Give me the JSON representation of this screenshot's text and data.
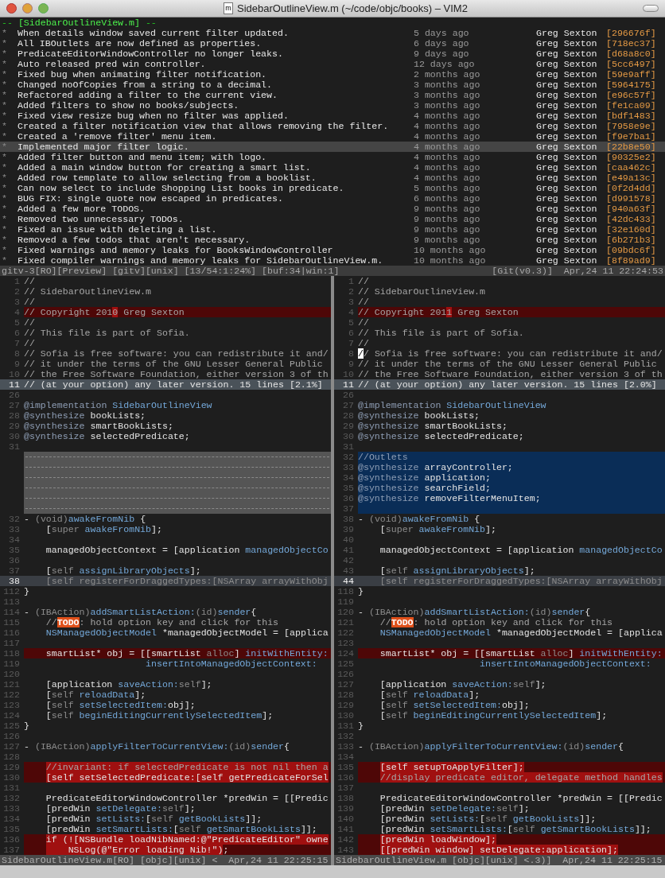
{
  "window": {
    "title": "SidebarOutlineView.m (~/code/objc/books) – VIM2",
    "file_icon": "m"
  },
  "log": {
    "header": {
      "prefix": "-- ",
      "name": "[SidebarOutlineView.m]",
      "suffix": " --"
    },
    "entries": [
      {
        "marker": "*",
        "message": "When details window saved current filter updated.",
        "age": "5 days ago",
        "author": "Greg Sexton",
        "hash": "[296676f]",
        "selected": false
      },
      {
        "marker": "*",
        "message": "All IBOutlets are now defined as properties.",
        "age": "6 days ago",
        "author": "Greg Sexton",
        "hash": "[718ec37]",
        "selected": false
      },
      {
        "marker": "*",
        "message": "PredicateEditorWindowController no longer leaks.",
        "age": "9 days ago",
        "author": "Greg Sexton",
        "hash": "[d68a8c0]",
        "selected": false
      },
      {
        "marker": "*",
        "message": "Auto released pred win controller.",
        "age": "12 days ago",
        "author": "Greg Sexton",
        "hash": "[5cc6497]",
        "selected": false
      },
      {
        "marker": "*",
        "message": "Fixed bug when animating filter notification.",
        "age": "2 months ago",
        "author": "Greg Sexton",
        "hash": "[59e9aff]",
        "selected": false
      },
      {
        "marker": "*",
        "message": "Changed noOfCopies from a string to a decimal.",
        "age": "3 months ago",
        "author": "Greg Sexton",
        "hash": "[5964175]",
        "selected": false
      },
      {
        "marker": "*",
        "message": "Refactored adding a filter to the current view.",
        "age": "3 months ago",
        "author": "Greg Sexton",
        "hash": "[e96c57f]",
        "selected": false
      },
      {
        "marker": "*",
        "message": "Added filters to show no books/subjects.",
        "age": "3 months ago",
        "author": "Greg Sexton",
        "hash": "[fe1ca09]",
        "selected": false
      },
      {
        "marker": "*",
        "message": "Fixed view resize bug when no filter was applied.",
        "age": "4 months ago",
        "author": "Greg Sexton",
        "hash": "[bdf1483]",
        "selected": false
      },
      {
        "marker": "*",
        "message": "Created a filter notification view that allows removing the filter.",
        "age": "4 months ago",
        "author": "Greg Sexton",
        "hash": "[7958e9e]",
        "selected": false
      },
      {
        "marker": "*",
        "message": "Created a 'remove filter' menu item.",
        "age": "4 months ago",
        "author": "Greg Sexton",
        "hash": "[f9e7ba1]",
        "selected": false
      },
      {
        "marker": "*",
        "message": "Implemented major filter logic.",
        "age": "4 months ago",
        "author": "Greg Sexton",
        "hash": "[22b8e50]",
        "selected": true
      },
      {
        "marker": "*",
        "message": "Added filter button and menu item; with logo.",
        "age": "4 months ago",
        "author": "Greg Sexton",
        "hash": "[90325e2]",
        "selected": false
      },
      {
        "marker": "*",
        "message": "Added a main window button for creating a smart list.",
        "age": "4 months ago",
        "author": "Greg Sexton",
        "hash": "[caa462c]",
        "selected": false
      },
      {
        "marker": "*",
        "message": "Added row template to allow selecting from a booklist.",
        "age": "4 months ago",
        "author": "Greg Sexton",
        "hash": "[e49a13c]",
        "selected": false
      },
      {
        "marker": "*",
        "message": "Can now select to include Shopping List books in predicate.",
        "age": "5 months ago",
        "author": "Greg Sexton",
        "hash": "[0f2d4dd]",
        "selected": false
      },
      {
        "marker": "*",
        "message": "BUG FIX: single quote now escaped in predicates.",
        "age": "6 months ago",
        "author": "Greg Sexton",
        "hash": "[d991578]",
        "selected": false
      },
      {
        "marker": "*",
        "message": "Added a few more TODOS.",
        "age": "9 months ago",
        "author": "Greg Sexton",
        "hash": "[940a63f]",
        "selected": false
      },
      {
        "marker": "*",
        "message": "Removed two unnecessary TODOs.",
        "age": "9 months ago",
        "author": "Greg Sexton",
        "hash": "[42dc433]",
        "selected": false
      },
      {
        "marker": "*",
        "message": "Fixed an issue with deleting a list.",
        "age": "9 months ago",
        "author": "Greg Sexton",
        "hash": "[32e160d]",
        "selected": false
      },
      {
        "marker": "*",
        "message": "Removed a few todos that aren't necessary.",
        "age": "9 months ago",
        "author": "Greg Sexton",
        "hash": "[6b271b3]",
        "selected": false
      },
      {
        "marker": "*",
        "message": "Fixed warnings and memory leaks for BooksWindowController",
        "age": "10 months ago",
        "author": "Greg Sexton",
        "hash": "[09bdc6f]",
        "selected": false
      },
      {
        "marker": "*",
        "message": "Fixed compiler warnings and memory leaks for SidebarOutlineView.m.",
        "age": "10 months ago",
        "author": "Greg Sexton",
        "hash": "[8f89ad9]",
        "selected": false
      }
    ],
    "status_bar": {
      "left": "gitv-3[RO][Preview] [gitv][unix] [13/54:1:24%] [buf:34|win:1]",
      "right": "[Git(v0.3)]  Apr,24 11 22:24:53"
    }
  },
  "panes": [
    {
      "lines": [
        {
          "n": "1",
          "kind": "normal",
          "parts": [
            {
              "kind": "comment",
              "t": "//"
            }
          ]
        },
        {
          "n": "2",
          "kind": "normal",
          "parts": [
            {
              "kind": "comment",
              "t": "// SidebarOutlineView.m"
            }
          ]
        },
        {
          "n": "3",
          "kind": "normal",
          "parts": [
            {
              "kind": "comment",
              "t": "//"
            }
          ]
        },
        {
          "n": "4",
          "kind": "change",
          "parts": [
            {
              "kind": "comment",
              "t": "// Copyright 201",
              "diff": false
            },
            {
              "kind": "comment",
              "t": "0",
              "diff": true
            },
            {
              "kind": "comment",
              "t": " Greg Sexton",
              "diff": false
            }
          ]
        },
        {
          "n": "5",
          "kind": "normal",
          "parts": [
            {
              "kind": "comment",
              "t": "//"
            }
          ]
        },
        {
          "n": "6",
          "kind": "normal",
          "parts": [
            {
              "kind": "comment",
              "t": "// This file is part of Sofia."
            }
          ]
        },
        {
          "n": "7",
          "kind": "normal",
          "parts": [
            {
              "kind": "comment",
              "t": "//"
            }
          ]
        },
        {
          "n": "8",
          "kind": "normal",
          "parts": [
            {
              "kind": "comment",
              "t": "// Sofia is free software: you can redistribute it and/"
            }
          ]
        },
        {
          "n": "9",
          "kind": "normal",
          "parts": [
            {
              "kind": "comment",
              "t": "// it under the terms of the GNU Lesser General Public"
            }
          ]
        },
        {
          "n": "10",
          "kind": "normal",
          "parts": [
            {
              "kind": "comment",
              "t": "// the Free Software Foundation, either version 3 of th"
            }
          ]
        },
        {
          "n": "11",
          "kind": "fold",
          "parts": [
            {
              "kind": "plain",
              "t": "// (at your option) any later version. 15 lines [2.1%]"
            }
          ]
        },
        {
          "n": "26",
          "kind": "normal"
        },
        {
          "n": "27",
          "kind": "normal",
          "parts": [
            {
              "kind": "keyword",
              "t": "@implementation "
            },
            {
              "kind": "method",
              "t": "SidebarOutlineView"
            }
          ]
        },
        {
          "n": "28",
          "kind": "normal",
          "parts": [
            {
              "kind": "keyword",
              "t": "@synthesize "
            },
            {
              "kind": "plain",
              "t": "bookLists;"
            }
          ]
        },
        {
          "n": "29",
          "kind": "normal",
          "parts": [
            {
              "kind": "keyword",
              "t": "@synthesize "
            },
            {
              "kind": "plain",
              "t": "smartBookLists;"
            }
          ]
        },
        {
          "n": "30",
          "kind": "normal",
          "parts": [
            {
              "kind": "keyword",
              "t": "@synthesize "
            },
            {
              "kind": "plain",
              "t": "selectedPredicate;"
            }
          ]
        },
        {
          "n": "31",
          "kind": "normal"
        },
        {
          "kind": "filler"
        },
        {
          "kind": "filler"
        },
        {
          "kind": "filler"
        },
        {
          "kind": "filler"
        },
        {
          "kind": "filler"
        },
        {
          "kind": "filler"
        },
        {
          "n": "32",
          "kind": "normal",
          "parts": [
            {
              "kind": "plain",
              "t": "- "
            },
            {
              "kind": "dim",
              "t": "(void)"
            },
            {
              "kind": "method",
              "t": "awakeFromNib"
            },
            {
              "kind": "plain",
              "t": " {"
            }
          ]
        },
        {
          "n": "33",
          "kind": "normal",
          "parts": [
            {
              "kind": "plain",
              "t": "    ["
            },
            {
              "kind": "dim",
              "t": "super "
            },
            {
              "kind": "method",
              "t": "awakeFromNib"
            },
            {
              "kind": "plain",
              "t": "];"
            }
          ]
        },
        {
          "n": "34",
          "kind": "normal"
        },
        {
          "n": "35",
          "kind": "normal",
          "parts": [
            {
              "kind": "plain",
              "t": "    managedObjectContext = [application "
            },
            {
              "kind": "method",
              "t": "managedObjectCo"
            }
          ]
        },
        {
          "n": "36",
          "kind": "normal"
        },
        {
          "n": "37",
          "kind": "normal",
          "parts": [
            {
              "kind": "plain",
              "t": "    ["
            },
            {
              "kind": "dim",
              "t": "self "
            },
            {
              "kind": "method",
              "t": "assignLibraryObjects"
            },
            {
              "kind": "plain",
              "t": "];"
            }
          ]
        },
        {
          "n": "38",
          "kind": "cursorline",
          "parts": [
            {
              "kind": "dim",
              "t": "    [self registerForDraggedTypes:[NSArray arrayWithObj"
            }
          ]
        },
        {
          "n": "112",
          "kind": "normal",
          "parts": [
            {
              "kind": "plain",
              "t": "}"
            }
          ]
        },
        {
          "n": "113",
          "kind": "normal"
        },
        {
          "n": "114",
          "kind": "normal",
          "parts": [
            {
              "kind": "plain",
              "t": "- "
            },
            {
              "kind": "dim",
              "t": "(IBAction)"
            },
            {
              "kind": "method",
              "t": "addSmartListAction:"
            },
            {
              "kind": "dim",
              "t": "(id)"
            },
            {
              "kind": "method",
              "t": "sender"
            },
            {
              "kind": "plain",
              "t": "{"
            }
          ]
        },
        {
          "n": "115",
          "kind": "normal",
          "parts": [
            {
              "kind": "comment",
              "t": "    //"
            },
            {
              "kind": "todo",
              "t": "TODO"
            },
            {
              "kind": "comment",
              "t": ": hold option key and click for this"
            }
          ]
        },
        {
          "n": "116",
          "kind": "normal",
          "parts": [
            {
              "kind": "method",
              "t": "    NSManagedObjectModel"
            },
            {
              "kind": "plain",
              "t": " *managedObjectModel = [applica"
            }
          ]
        },
        {
          "n": "117",
          "kind": "normal"
        },
        {
          "n": "118",
          "kind": "change",
          "parts": [
            {
              "kind": "plain",
              "t": "    smartList* obj = [[smartList "
            },
            {
              "kind": "dim",
              "t": "alloc"
            },
            {
              "kind": "plain",
              "t": "] "
            },
            {
              "kind": "method",
              "t": "initWithEntity:"
            }
          ]
        },
        {
          "n": "119",
          "kind": "normal",
          "parts": [
            {
              "kind": "method",
              "t": "                      insertIntoManagedObjectContext:"
            }
          ]
        },
        {
          "n": "120",
          "kind": "normal"
        },
        {
          "n": "121",
          "kind": "normal",
          "parts": [
            {
              "kind": "plain",
              "t": "    [application "
            },
            {
              "kind": "method",
              "t": "saveAction:"
            },
            {
              "kind": "dim",
              "t": "self"
            },
            {
              "kind": "plain",
              "t": "];"
            }
          ]
        },
        {
          "n": "122",
          "kind": "normal",
          "parts": [
            {
              "kind": "plain",
              "t": "    ["
            },
            {
              "kind": "dim",
              "t": "self "
            },
            {
              "kind": "method",
              "t": "reloadData"
            },
            {
              "kind": "plain",
              "t": "];"
            }
          ]
        },
        {
          "n": "123",
          "kind": "normal",
          "parts": [
            {
              "kind": "plain",
              "t": "    ["
            },
            {
              "kind": "dim",
              "t": "self "
            },
            {
              "kind": "method",
              "t": "setSelectedItem:"
            },
            {
              "kind": "plain",
              "t": "obj];"
            }
          ]
        },
        {
          "n": "124",
          "kind": "normal",
          "parts": [
            {
              "kind": "plain",
              "t": "    ["
            },
            {
              "kind": "dim",
              "t": "self "
            },
            {
              "kind": "method",
              "t": "beginEditingCurrentlySelectedItem"
            },
            {
              "kind": "plain",
              "t": "];"
            }
          ]
        },
        {
          "n": "125",
          "kind": "normal",
          "parts": [
            {
              "kind": "plain",
              "t": "}"
            }
          ]
        },
        {
          "n": "126",
          "kind": "normal"
        },
        {
          "n": "127",
          "kind": "normal",
          "parts": [
            {
              "kind": "plain",
              "t": "- "
            },
            {
              "kind": "dim",
              "t": "(IBAction)"
            },
            {
              "kind": "method",
              "t": "applyFilterToCurrentView:"
            },
            {
              "kind": "dim",
              "t": "(id)"
            },
            {
              "kind": "method",
              "t": "sender"
            },
            {
              "kind": "plain",
              "t": "{"
            }
          ]
        },
        {
          "n": "128",
          "kind": "normal"
        },
        {
          "n": "129",
          "kind": "change",
          "indent": true,
          "parts": [
            {
              "kind": "comment",
              "t": "//invariant: if selectedPredicate is not nil then a",
              "diff": true
            }
          ]
        },
        {
          "n": "130",
          "kind": "change",
          "indent": true,
          "parts": [
            {
              "kind": "plain",
              "t": "[self setSelectedPredicate:[self getPredicateForSel",
              "diff": true
            }
          ]
        },
        {
          "n": "131",
          "kind": "normal"
        },
        {
          "n": "132",
          "kind": "normal",
          "parts": [
            {
              "kind": "plain",
              "t": "    PredicateEditorWindowController *predWin = [[Predic"
            }
          ]
        },
        {
          "n": "133",
          "kind": "normal",
          "parts": [
            {
              "kind": "plain",
              "t": "    [predWin "
            },
            {
              "kind": "method",
              "t": "setDelegate:"
            },
            {
              "kind": "dim",
              "t": "self"
            },
            {
              "kind": "plain",
              "t": "];"
            }
          ]
        },
        {
          "n": "134",
          "kind": "normal",
          "parts": [
            {
              "kind": "plain",
              "t": "    [predWin "
            },
            {
              "kind": "method",
              "t": "setLists:"
            },
            {
              "kind": "plain",
              "t": "["
            },
            {
              "kind": "dim",
              "t": "self "
            },
            {
              "kind": "method",
              "t": "getBookLists"
            },
            {
              "kind": "plain",
              "t": "]];"
            }
          ]
        },
        {
          "n": "135",
          "kind": "normal",
          "parts": [
            {
              "kind": "plain",
              "t": "    [predWin "
            },
            {
              "kind": "method",
              "t": "setSmartLists:"
            },
            {
              "kind": "plain",
              "t": "["
            },
            {
              "kind": "dim",
              "t": "self "
            },
            {
              "kind": "method",
              "t": "getSmartBookLists"
            },
            {
              "kind": "plain",
              "t": "]];"
            }
          ]
        },
        {
          "n": "136",
          "kind": "change",
          "indent": true,
          "parts": [
            {
              "kind": "plain",
              "t": "if (![NSBundle loadNibNamed:@\"PredicateEditor\" owne",
              "diff": true
            }
          ]
        },
        {
          "n": "137",
          "kind": "change",
          "indent": true,
          "parts": [
            {
              "kind": "plain",
              "t": "    NSLog(@\"Error loading Nib!\")",
              "diff": true
            },
            {
              "kind": "plain",
              "t": ";",
              "diff": false
            }
          ]
        }
      ],
      "status_bar": "SidebarOutlineView.m[RO] [objc][unix] <  Apr,24 11 22:25:15"
    },
    {
      "lines": [
        {
          "n": "1",
          "kind": "normal",
          "parts": [
            {
              "kind": "comment",
              "t": "//"
            }
          ]
        },
        {
          "n": "2",
          "kind": "normal",
          "parts": [
            {
              "kind": "comment",
              "t": "// SidebarOutlineView.m"
            }
          ]
        },
        {
          "n": "3",
          "kind": "normal",
          "parts": [
            {
              "kind": "comment",
              "t": "//"
            }
          ]
        },
        {
          "n": "4",
          "kind": "change",
          "parts": [
            {
              "kind": "comment",
              "t": "// Copyright 201",
              "diff": false
            },
            {
              "kind": "comment",
              "t": "1",
              "diff": true
            },
            {
              "kind": "comment",
              "t": " Greg Sexton",
              "diff": false
            }
          ]
        },
        {
          "n": "5",
          "kind": "normal",
          "parts": [
            {
              "kind": "comment",
              "t": "//"
            }
          ]
        },
        {
          "n": "6",
          "kind": "normal",
          "parts": [
            {
              "kind": "comment",
              "t": "// This file is part of Sofia."
            }
          ]
        },
        {
          "n": "7",
          "kind": "normal",
          "parts": [
            {
              "kind": "comment",
              "t": "//"
            }
          ]
        },
        {
          "n": "8",
          "kind": "normal",
          "parts": [
            {
              "kind": "cursor",
              "t": "/"
            },
            {
              "kind": "comment",
              "t": "/ Sofia is free software: you can redistribute it and/"
            }
          ]
        },
        {
          "n": "9",
          "kind": "normal",
          "parts": [
            {
              "kind": "comment",
              "t": "// it under the terms of the GNU Lesser General Public"
            }
          ]
        },
        {
          "n": "10",
          "kind": "normal",
          "parts": [
            {
              "kind": "comment",
              "t": "// the Free Software Foundation, either version 3 of th"
            }
          ]
        },
        {
          "n": "11",
          "kind": "fold",
          "parts": [
            {
              "kind": "plain",
              "t": "// (at your option) any later version. 15 lines [2.0%]"
            }
          ]
        },
        {
          "n": "26",
          "kind": "normal"
        },
        {
          "n": "27",
          "kind": "normal",
          "parts": [
            {
              "kind": "keyword",
              "t": "@implementation "
            },
            {
              "kind": "method",
              "t": "SidebarOutlineView"
            }
          ]
        },
        {
          "n": "28",
          "kind": "normal",
          "parts": [
            {
              "kind": "keyword",
              "t": "@synthesize "
            },
            {
              "kind": "plain",
              "t": "bookLists;"
            }
          ]
        },
        {
          "n": "29",
          "kind": "normal",
          "parts": [
            {
              "kind": "keyword",
              "t": "@synthesize "
            },
            {
              "kind": "plain",
              "t": "smartBookLists;"
            }
          ]
        },
        {
          "n": "30",
          "kind": "normal",
          "parts": [
            {
              "kind": "keyword",
              "t": "@synthesize "
            },
            {
              "kind": "plain",
              "t": "selectedPredicate;"
            }
          ]
        },
        {
          "n": "31",
          "kind": "normal"
        },
        {
          "n": "32",
          "kind": "add",
          "parts": [
            {
              "kind": "keyword",
              "t": "//Outlets"
            }
          ]
        },
        {
          "n": "33",
          "kind": "add",
          "parts": [
            {
              "kind": "keyword",
              "t": "@synthesize "
            },
            {
              "kind": "plain",
              "t": "arrayController;"
            }
          ]
        },
        {
          "n": "34",
          "kind": "add",
          "parts": [
            {
              "kind": "keyword",
              "t": "@synthesize "
            },
            {
              "kind": "plain",
              "t": "application;"
            }
          ]
        },
        {
          "n": "35",
          "kind": "add",
          "parts": [
            {
              "kind": "keyword",
              "t": "@synthesize "
            },
            {
              "kind": "plain",
              "t": "searchField;"
            }
          ]
        },
        {
          "n": "36",
          "kind": "add",
          "parts": [
            {
              "kind": "keyword",
              "t": "@synthesize "
            },
            {
              "kind": "plain",
              "t": "removeFilterMenuItem;"
            }
          ]
        },
        {
          "n": "37",
          "kind": "add"
        },
        {
          "n": "38",
          "kind": "normal",
          "parts": [
            {
              "kind": "plain",
              "t": "- "
            },
            {
              "kind": "dim",
              "t": "(void)"
            },
            {
              "kind": "method",
              "t": "awakeFromNib"
            },
            {
              "kind": "plain",
              "t": " {"
            }
          ]
        },
        {
          "n": "39",
          "kind": "normal",
          "parts": [
            {
              "kind": "plain",
              "t": "    ["
            },
            {
              "kind": "dim",
              "t": "super "
            },
            {
              "kind": "method",
              "t": "awakeFromNib"
            },
            {
              "kind": "plain",
              "t": "];"
            }
          ]
        },
        {
          "n": "40",
          "kind": "normal"
        },
        {
          "n": "41",
          "kind": "normal",
          "parts": [
            {
              "kind": "plain",
              "t": "    managedObjectContext = [application "
            },
            {
              "kind": "method",
              "t": "managedObjectCo"
            }
          ]
        },
        {
          "n": "42",
          "kind": "normal"
        },
        {
          "n": "43",
          "kind": "normal",
          "parts": [
            {
              "kind": "plain",
              "t": "    ["
            },
            {
              "kind": "dim",
              "t": "self "
            },
            {
              "kind": "method",
              "t": "assignLibraryObjects"
            },
            {
              "kind": "plain",
              "t": "];"
            }
          ]
        },
        {
          "n": "44",
          "kind": "cursorline",
          "parts": [
            {
              "kind": "dim",
              "t": "    [self registerForDraggedTypes:[NSArray arrayWithObj"
            }
          ]
        },
        {
          "n": "118",
          "kind": "normal",
          "parts": [
            {
              "kind": "plain",
              "t": "}"
            }
          ]
        },
        {
          "n": "119",
          "kind": "normal"
        },
        {
          "n": "120",
          "kind": "normal",
          "parts": [
            {
              "kind": "plain",
              "t": "- "
            },
            {
              "kind": "dim",
              "t": "(IBAction)"
            },
            {
              "kind": "method",
              "t": "addSmartListAction:"
            },
            {
              "kind": "dim",
              "t": "(id)"
            },
            {
              "kind": "method",
              "t": "sender"
            },
            {
              "kind": "plain",
              "t": "{"
            }
          ]
        },
        {
          "n": "121",
          "kind": "normal",
          "parts": [
            {
              "kind": "comment",
              "t": "    //"
            },
            {
              "kind": "todo",
              "t": "TODO"
            },
            {
              "kind": "comment",
              "t": ": hold option key and click for this"
            }
          ]
        },
        {
          "n": "122",
          "kind": "normal",
          "parts": [
            {
              "kind": "method",
              "t": "    NSManagedObjectModel"
            },
            {
              "kind": "plain",
              "t": " *managedObjectModel = [applica"
            }
          ]
        },
        {
          "n": "123",
          "kind": "normal"
        },
        {
          "n": "124",
          "kind": "change",
          "parts": [
            {
              "kind": "plain",
              "t": "    smartList* obj = [[smartList "
            },
            {
              "kind": "dim",
              "t": "alloc"
            },
            {
              "kind": "plain",
              "t": "] "
            },
            {
              "kind": "method",
              "t": "initWithEntity:"
            }
          ]
        },
        {
          "n": "125",
          "kind": "normal",
          "parts": [
            {
              "kind": "method",
              "t": "                      insertIntoManagedObjectContext:"
            }
          ]
        },
        {
          "n": "126",
          "kind": "normal"
        },
        {
          "n": "127",
          "kind": "normal",
          "parts": [
            {
              "kind": "plain",
              "t": "    [application "
            },
            {
              "kind": "method",
              "t": "saveAction:"
            },
            {
              "kind": "dim",
              "t": "self"
            },
            {
              "kind": "plain",
              "t": "];"
            }
          ]
        },
        {
          "n": "128",
          "kind": "normal",
          "parts": [
            {
              "kind": "plain",
              "t": "    ["
            },
            {
              "kind": "dim",
              "t": "self "
            },
            {
              "kind": "method",
              "t": "reloadData"
            },
            {
              "kind": "plain",
              "t": "];"
            }
          ]
        },
        {
          "n": "129",
          "kind": "normal",
          "parts": [
            {
              "kind": "plain",
              "t": "    ["
            },
            {
              "kind": "dim",
              "t": "self "
            },
            {
              "kind": "method",
              "t": "setSelectedItem:"
            },
            {
              "kind": "plain",
              "t": "obj];"
            }
          ]
        },
        {
          "n": "130",
          "kind": "normal",
          "parts": [
            {
              "kind": "plain",
              "t": "    ["
            },
            {
              "kind": "dim",
              "t": "self "
            },
            {
              "kind": "method",
              "t": "beginEditingCurrentlySelectedItem"
            },
            {
              "kind": "plain",
              "t": "];"
            }
          ]
        },
        {
          "n": "131",
          "kind": "normal",
          "parts": [
            {
              "kind": "plain",
              "t": "}"
            }
          ]
        },
        {
          "n": "132",
          "kind": "normal"
        },
        {
          "n": "133",
          "kind": "normal",
          "parts": [
            {
              "kind": "plain",
              "t": "- "
            },
            {
              "kind": "dim",
              "t": "(IBAction)"
            },
            {
              "kind": "method",
              "t": "applyFilterToCurrentView:"
            },
            {
              "kind": "dim",
              "t": "(id)"
            },
            {
              "kind": "method",
              "t": "sender"
            },
            {
              "kind": "plain",
              "t": "{"
            }
          ]
        },
        {
          "n": "134",
          "kind": "normal"
        },
        {
          "n": "135",
          "kind": "change",
          "indent": true,
          "parts": [
            {
              "kind": "plain",
              "t": "[self setupToApplyFilter];",
              "diff": true
            }
          ]
        },
        {
          "n": "136",
          "kind": "change",
          "indent": true,
          "parts": [
            {
              "kind": "comment",
              "t": "//display predicate editor, delegate method handles",
              "diff": true
            }
          ]
        },
        {
          "n": "137",
          "kind": "normal"
        },
        {
          "n": "138",
          "kind": "normal",
          "parts": [
            {
              "kind": "plain",
              "t": "    PredicateEditorWindowController *predWin = [[Predic"
            }
          ]
        },
        {
          "n": "139",
          "kind": "normal",
          "parts": [
            {
              "kind": "plain",
              "t": "    [predWin "
            },
            {
              "kind": "method",
              "t": "setDelegate:"
            },
            {
              "kind": "dim",
              "t": "self"
            },
            {
              "kind": "plain",
              "t": "];"
            }
          ]
        },
        {
          "n": "140",
          "kind": "normal",
          "parts": [
            {
              "kind": "plain",
              "t": "    [predWin "
            },
            {
              "kind": "method",
              "t": "setLists:"
            },
            {
              "kind": "plain",
              "t": "["
            },
            {
              "kind": "dim",
              "t": "self "
            },
            {
              "kind": "method",
              "t": "getBookLists"
            },
            {
              "kind": "plain",
              "t": "]];"
            }
          ]
        },
        {
          "n": "141",
          "kind": "normal",
          "parts": [
            {
              "kind": "plain",
              "t": "    [predWin "
            },
            {
              "kind": "method",
              "t": "setSmartLists:"
            },
            {
              "kind": "plain",
              "t": "["
            },
            {
              "kind": "dim",
              "t": "self "
            },
            {
              "kind": "method",
              "t": "getSmartBookLists"
            },
            {
              "kind": "plain",
              "t": "]];"
            }
          ]
        },
        {
          "n": "142",
          "kind": "change",
          "indent": true,
          "parts": [
            {
              "kind": "plain",
              "t": "[predWin loadWindow];",
              "diff": true
            }
          ]
        },
        {
          "n": "143",
          "kind": "change",
          "indent": true,
          "parts": [
            {
              "kind": "plain",
              "t": "[[predWin window] setDelegate:application];",
              "diff": true
            }
          ]
        }
      ],
      "status_bar": "SidebarOutlineView.m [objc][unix] <.3)]  Apr,24 11 22:25:15"
    }
  ]
}
